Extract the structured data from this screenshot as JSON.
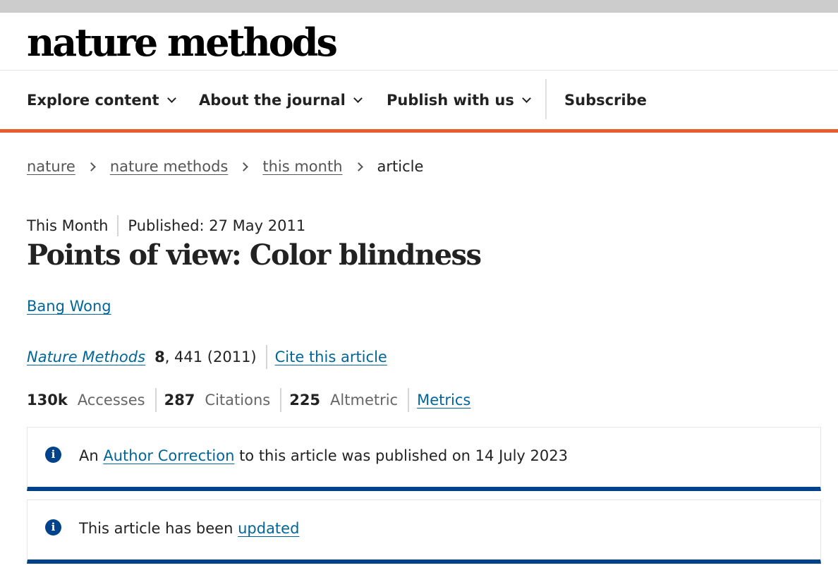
{
  "site": {
    "logo": "nature methods"
  },
  "nav": {
    "items": [
      {
        "label": "Explore content"
      },
      {
        "label": "About the journal"
      },
      {
        "label": "Publish with us"
      },
      {
        "label": "Subscribe"
      }
    ]
  },
  "breadcrumb": {
    "items": [
      "nature",
      "nature methods",
      "this month"
    ],
    "current": "article"
  },
  "article": {
    "type": "This Month",
    "published": "Published: 27 May 2011",
    "title": "Points of view: Color blindness",
    "author": "Bang Wong",
    "journal": "Nature Methods",
    "volume": "8",
    "pages_year": ", 441 (2011)",
    "cite_label": "Cite this article"
  },
  "metrics": {
    "accesses_value": "130k",
    "accesses_label": "Accesses",
    "citations_value": "287",
    "citations_label": "Citations",
    "altmetric_value": "225",
    "altmetric_label": "Altmetric",
    "link_label": "Metrics"
  },
  "notices": {
    "correction": {
      "prefix": "An ",
      "link": "Author Correction",
      "suffix": " to this article was published on 14 July 2023"
    },
    "update": {
      "prefix": "This article has been ",
      "link": "updated"
    }
  },
  "colors": {
    "accent_orange": "#e85b2a",
    "link_blue": "#006699",
    "notice_navy": "#01428a"
  }
}
